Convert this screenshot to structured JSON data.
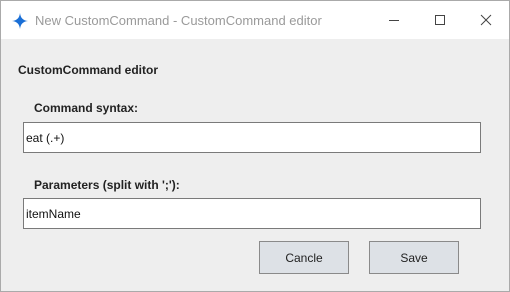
{
  "window": {
    "title": "New CustomCommand - CustomCommand editor",
    "icons": {
      "app": "sparkle-icon",
      "minimize": "minimize-icon",
      "maximize": "maximize-icon",
      "close": "close-icon"
    }
  },
  "editor": {
    "heading": "CustomCommand editor",
    "syntax_label": "Command syntax:",
    "syntax_value": "eat (.+)",
    "params_label": "Parameters (split with ';'):",
    "params_value": "itemName"
  },
  "buttons": {
    "cancel_label": "Cancle",
    "save_label": "Save"
  },
  "colors": {
    "accent": "#1a6fd6",
    "window_bg": "#eeeeee",
    "button_bg": "#dde1e6"
  }
}
